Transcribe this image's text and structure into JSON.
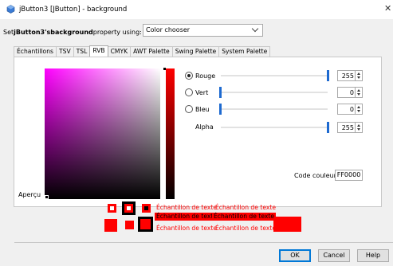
{
  "window": {
    "title": "jButton3 [JButton] - background",
    "close_icon": "close-icon"
  },
  "setrow": {
    "prefix": "Set ",
    "component": "jButton3's",
    "property": " background",
    "suffix": " property using:"
  },
  "combo": {
    "value": "Color chooser"
  },
  "tabs": [
    {
      "label": "Échantillons"
    },
    {
      "label": "TSV"
    },
    {
      "label": "TSL"
    },
    {
      "label": "RVB",
      "active": true
    },
    {
      "label": "CMYK"
    },
    {
      "label": "AWT Palette"
    },
    {
      "label": "Swing Palette"
    },
    {
      "label": "System Palette"
    }
  ],
  "rvb": {
    "channels": [
      {
        "label": "Rouge",
        "value": "255",
        "level": 1.0,
        "selected": true
      },
      {
        "label": "Vert",
        "value": "0",
        "level": 0.0,
        "selected": false
      },
      {
        "label": "Bleu",
        "value": "0",
        "level": 0.0,
        "selected": false
      }
    ],
    "alpha": {
      "label": "Alpha",
      "value": "255",
      "level": 1.0
    }
  },
  "code": {
    "label": "Code couleur",
    "value": "FF0000"
  },
  "apercu": {
    "label": "Aperçu",
    "sample_text": "Échantillon de texte",
    "color": "#ff0000"
  },
  "buttons": {
    "ok": "OK",
    "cancel": "Cancel",
    "help": "Help"
  }
}
